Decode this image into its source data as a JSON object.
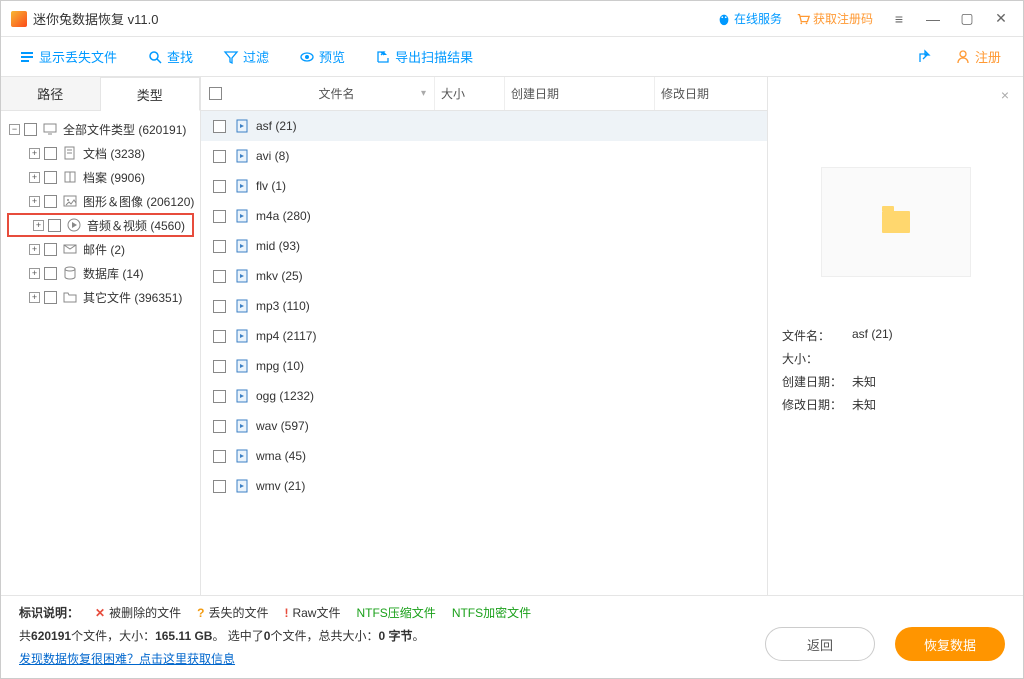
{
  "app": {
    "title": "迷你兔数据恢复 v11.0"
  },
  "titlebar": {
    "online_service": "在线服务",
    "get_reg": "获取注册码"
  },
  "toolbar": {
    "show_lost": "显示丢失文件",
    "find": "查找",
    "filter": "过滤",
    "preview": "预览",
    "export": "导出扫描结果",
    "register": "注册"
  },
  "tabs": {
    "path": "路径",
    "type": "类型"
  },
  "tree": {
    "all": "全部文件类型 (620191)",
    "docs": "文档 (3238)",
    "archive": "档案 (9906)",
    "images": "图形＆图像 (206120)",
    "av": "音频＆视频 (4560)",
    "mail": "邮件 (2)",
    "db": "数据库 (14)",
    "other": "其它文件 (396351)"
  },
  "columns": {
    "name": "文件名",
    "size": "大小",
    "cdate": "创建日期",
    "mdate": "修改日期"
  },
  "files": [
    "asf (21)",
    "avi (8)",
    "flv (1)",
    "m4a (280)",
    "mid (93)",
    "mkv (25)",
    "mp3 (110)",
    "mp4 (2117)",
    "mpg (10)",
    "ogg (1232)",
    "wav (597)",
    "wma (45)",
    "wmv (21)"
  ],
  "preview": {
    "fname_label": "文件名：",
    "fname_value": "asf (21)",
    "size_label": "大小：",
    "size_value": "",
    "cdate_label": "创建日期：",
    "cdate_value": "未知",
    "mdate_label": "修改日期：",
    "mdate_value": "未知"
  },
  "footer": {
    "legend_label": "标识说明：",
    "deleted": "被删除的文件",
    "lost": "丢失的文件",
    "raw": "Raw文件",
    "ntfs_comp": "NTFS压缩文件",
    "ntfs_enc": "NTFS加密文件",
    "stats_prefix": "共",
    "stats_count": "620191",
    "stats_mid1": "个文件，大小：",
    "stats_total_size": "165.11 GB",
    "stats_mid2": "。 选中了",
    "stats_selected": "0",
    "stats_mid3": "个文件，总共大小：",
    "stats_sel_size": "0 字节",
    "stats_end": "。",
    "help": "发现数据恢复很困难？点击这里获取信息",
    "back": "返回",
    "recover": "恢复数据"
  }
}
